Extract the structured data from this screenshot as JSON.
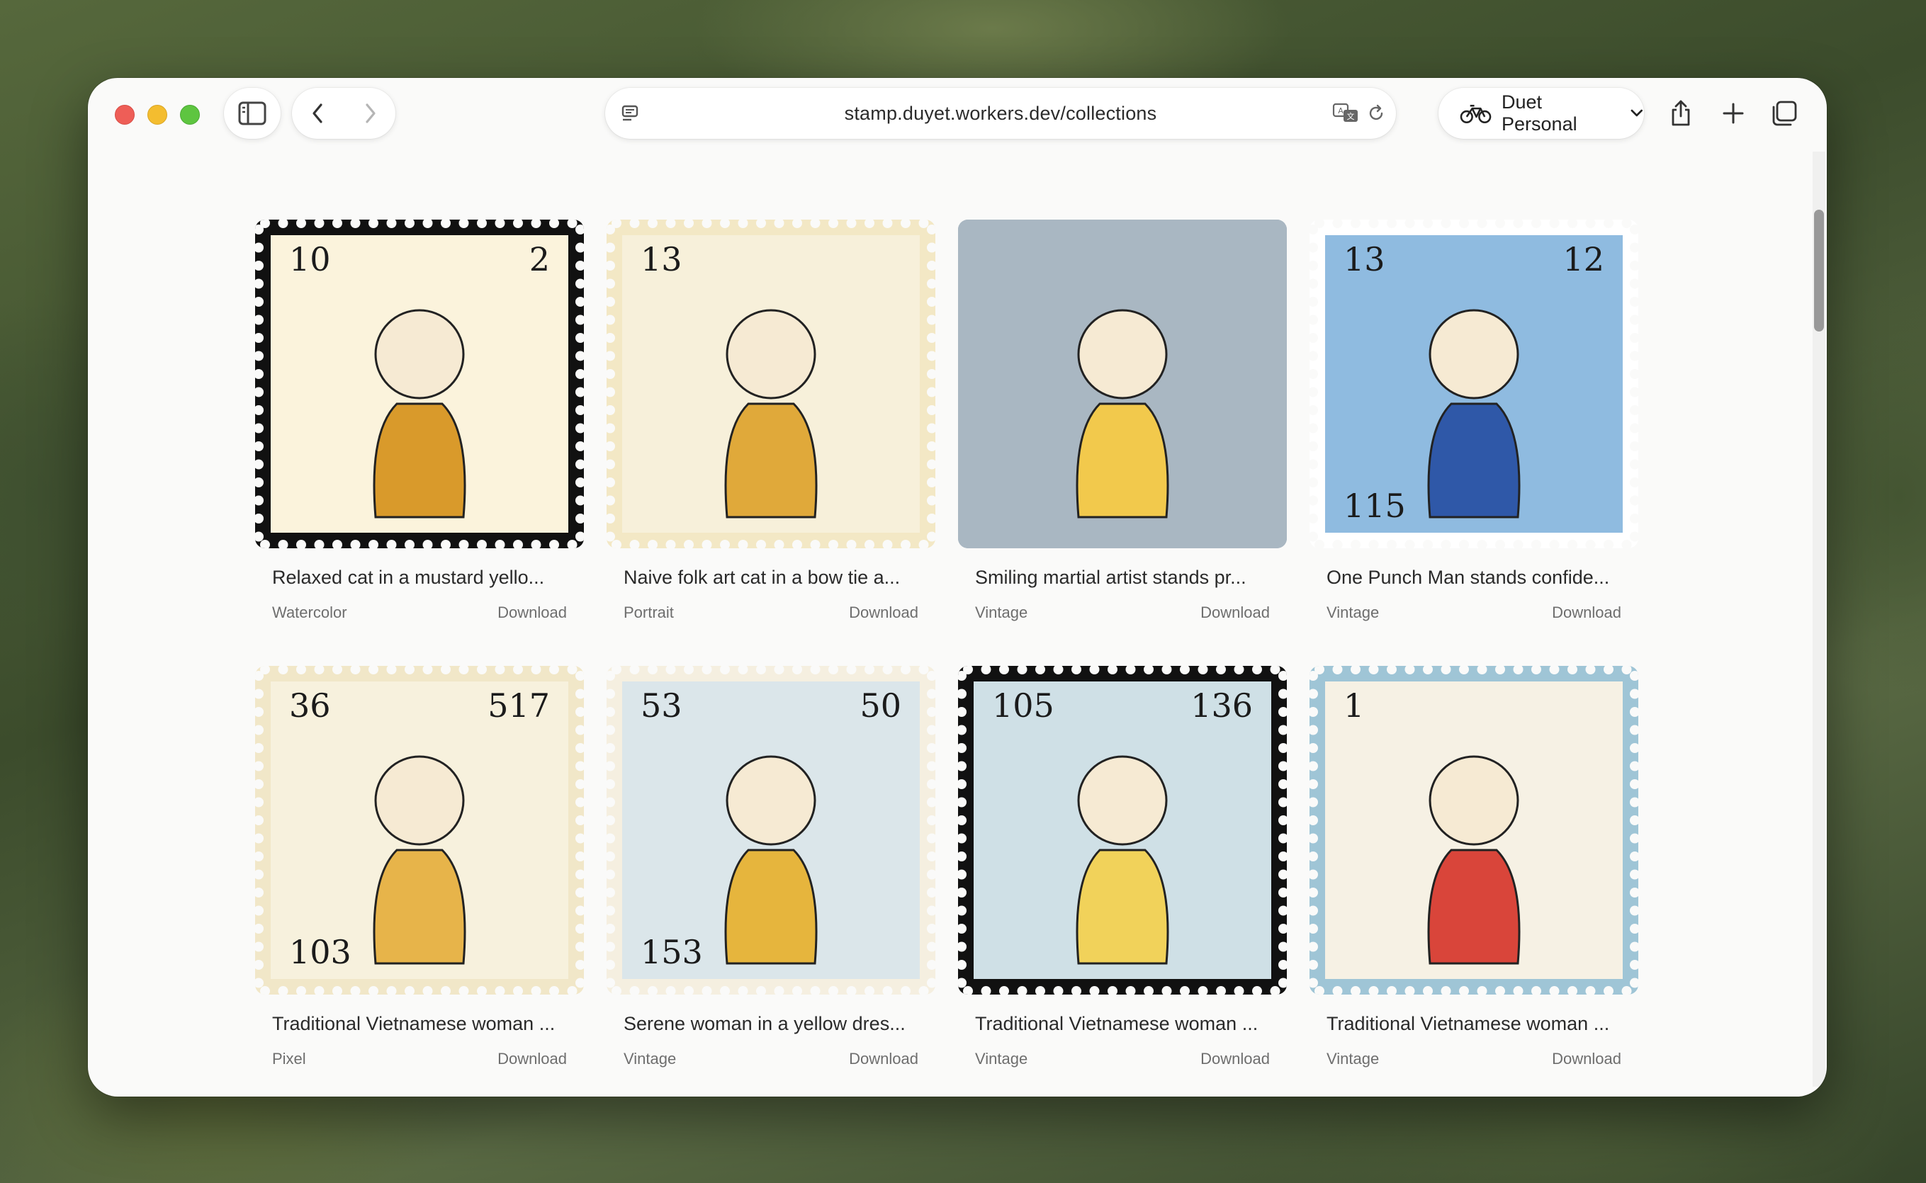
{
  "browser": {
    "url": "stamp.duyet.workers.dev/collections",
    "profile_name": "Duet Personal",
    "icons": {
      "sidebar": "sidebar-icon",
      "back": "chevron-left-icon",
      "forward": "chevron-right-icon",
      "reader": "reader-icon",
      "translate": "translate-icon",
      "reload": "reload-icon",
      "profile": "bicycle-icon",
      "share": "share-icon",
      "new_tab": "plus-icon",
      "tabs": "tabs-icon"
    }
  },
  "collections": [
    {
      "title": "Relaxed cat in a mustard yello...",
      "style": "Watercolor",
      "download": "Download",
      "numbers": [
        "10",
        "2"
      ],
      "bg": "#fbf3dc",
      "frame": "#111111",
      "accent": "#d99a2b"
    },
    {
      "title": "Naive folk art cat in a bow tie a...",
      "style": "Portrait",
      "download": "Download",
      "numbers": [
        "13"
      ],
      "bg": "#f7f0da",
      "frame": "#f3e8c5",
      "accent": "#e0a93a"
    },
    {
      "title": "Smiling martial artist stands pr...",
      "style": "Vintage",
      "download": "Download",
      "numbers": [],
      "bg": "#a9b7c2",
      "frame": "#a9b7c2",
      "accent": "#f2c94c"
    },
    {
      "title": "One Punch Man stands confide...",
      "style": "Vintage",
      "download": "Download",
      "numbers": [
        "13",
        "12",
        "115"
      ],
      "bg": "#8fbbe0",
      "frame": "#ffffff",
      "accent": "#2f58a8"
    },
    {
      "title": "Traditional Vietnamese woman ...",
      "style": "Pixel",
      "download": "Download",
      "numbers": [
        "36",
        "517",
        "103"
      ],
      "bg": "#f7f1dd",
      "frame": "#f1e7c8",
      "accent": "#e7b44a"
    },
    {
      "title": "Serene woman in a yellow dres...",
      "style": "Vintage",
      "download": "Download",
      "numbers": [
        "53",
        "50",
        "153"
      ],
      "bg": "#dbe6ea",
      "frame": "#f5efe0",
      "accent": "#e6b53d"
    },
    {
      "title": "Traditional Vietnamese woman ...",
      "style": "Vintage",
      "download": "Download",
      "numbers": [
        "105",
        "136"
      ],
      "bg": "#cfe0e6",
      "frame": "#111111",
      "accent": "#f1d25a"
    },
    {
      "title": "Traditional Vietnamese woman ...",
      "style": "Vintage",
      "download": "Download",
      "numbers": [
        "1"
      ],
      "bg": "#f6f1e4",
      "frame": "#9fc5d6",
      "accent": "#d9453a"
    }
  ]
}
